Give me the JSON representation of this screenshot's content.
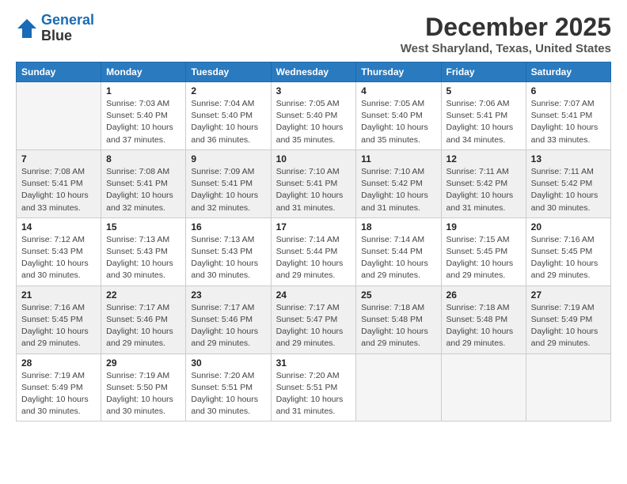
{
  "header": {
    "logo_line1": "General",
    "logo_line2": "Blue",
    "title": "December 2025",
    "location": "West Sharyland, Texas, United States"
  },
  "days_of_week": [
    "Sunday",
    "Monday",
    "Tuesday",
    "Wednesday",
    "Thursday",
    "Friday",
    "Saturday"
  ],
  "weeks": [
    [
      {
        "day": "",
        "info": ""
      },
      {
        "day": "1",
        "info": "Sunrise: 7:03 AM\nSunset: 5:40 PM\nDaylight: 10 hours\nand 37 minutes."
      },
      {
        "day": "2",
        "info": "Sunrise: 7:04 AM\nSunset: 5:40 PM\nDaylight: 10 hours\nand 36 minutes."
      },
      {
        "day": "3",
        "info": "Sunrise: 7:05 AM\nSunset: 5:40 PM\nDaylight: 10 hours\nand 35 minutes."
      },
      {
        "day": "4",
        "info": "Sunrise: 7:05 AM\nSunset: 5:40 PM\nDaylight: 10 hours\nand 35 minutes."
      },
      {
        "day": "5",
        "info": "Sunrise: 7:06 AM\nSunset: 5:41 PM\nDaylight: 10 hours\nand 34 minutes."
      },
      {
        "day": "6",
        "info": "Sunrise: 7:07 AM\nSunset: 5:41 PM\nDaylight: 10 hours\nand 33 minutes."
      }
    ],
    [
      {
        "day": "7",
        "info": "Sunrise: 7:08 AM\nSunset: 5:41 PM\nDaylight: 10 hours\nand 33 minutes."
      },
      {
        "day": "8",
        "info": "Sunrise: 7:08 AM\nSunset: 5:41 PM\nDaylight: 10 hours\nand 32 minutes."
      },
      {
        "day": "9",
        "info": "Sunrise: 7:09 AM\nSunset: 5:41 PM\nDaylight: 10 hours\nand 32 minutes."
      },
      {
        "day": "10",
        "info": "Sunrise: 7:10 AM\nSunset: 5:41 PM\nDaylight: 10 hours\nand 31 minutes."
      },
      {
        "day": "11",
        "info": "Sunrise: 7:10 AM\nSunset: 5:42 PM\nDaylight: 10 hours\nand 31 minutes."
      },
      {
        "day": "12",
        "info": "Sunrise: 7:11 AM\nSunset: 5:42 PM\nDaylight: 10 hours\nand 31 minutes."
      },
      {
        "day": "13",
        "info": "Sunrise: 7:11 AM\nSunset: 5:42 PM\nDaylight: 10 hours\nand 30 minutes."
      }
    ],
    [
      {
        "day": "14",
        "info": "Sunrise: 7:12 AM\nSunset: 5:43 PM\nDaylight: 10 hours\nand 30 minutes."
      },
      {
        "day": "15",
        "info": "Sunrise: 7:13 AM\nSunset: 5:43 PM\nDaylight: 10 hours\nand 30 minutes."
      },
      {
        "day": "16",
        "info": "Sunrise: 7:13 AM\nSunset: 5:43 PM\nDaylight: 10 hours\nand 30 minutes."
      },
      {
        "day": "17",
        "info": "Sunrise: 7:14 AM\nSunset: 5:44 PM\nDaylight: 10 hours\nand 29 minutes."
      },
      {
        "day": "18",
        "info": "Sunrise: 7:14 AM\nSunset: 5:44 PM\nDaylight: 10 hours\nand 29 minutes."
      },
      {
        "day": "19",
        "info": "Sunrise: 7:15 AM\nSunset: 5:45 PM\nDaylight: 10 hours\nand 29 minutes."
      },
      {
        "day": "20",
        "info": "Sunrise: 7:16 AM\nSunset: 5:45 PM\nDaylight: 10 hours\nand 29 minutes."
      }
    ],
    [
      {
        "day": "21",
        "info": "Sunrise: 7:16 AM\nSunset: 5:45 PM\nDaylight: 10 hours\nand 29 minutes."
      },
      {
        "day": "22",
        "info": "Sunrise: 7:17 AM\nSunset: 5:46 PM\nDaylight: 10 hours\nand 29 minutes."
      },
      {
        "day": "23",
        "info": "Sunrise: 7:17 AM\nSunset: 5:46 PM\nDaylight: 10 hours\nand 29 minutes."
      },
      {
        "day": "24",
        "info": "Sunrise: 7:17 AM\nSunset: 5:47 PM\nDaylight: 10 hours\nand 29 minutes."
      },
      {
        "day": "25",
        "info": "Sunrise: 7:18 AM\nSunset: 5:48 PM\nDaylight: 10 hours\nand 29 minutes."
      },
      {
        "day": "26",
        "info": "Sunrise: 7:18 AM\nSunset: 5:48 PM\nDaylight: 10 hours\nand 29 minutes."
      },
      {
        "day": "27",
        "info": "Sunrise: 7:19 AM\nSunset: 5:49 PM\nDaylight: 10 hours\nand 29 minutes."
      }
    ],
    [
      {
        "day": "28",
        "info": "Sunrise: 7:19 AM\nSunset: 5:49 PM\nDaylight: 10 hours\nand 30 minutes."
      },
      {
        "day": "29",
        "info": "Sunrise: 7:19 AM\nSunset: 5:50 PM\nDaylight: 10 hours\nand 30 minutes."
      },
      {
        "day": "30",
        "info": "Sunrise: 7:20 AM\nSunset: 5:51 PM\nDaylight: 10 hours\nand 30 minutes."
      },
      {
        "day": "31",
        "info": "Sunrise: 7:20 AM\nSunset: 5:51 PM\nDaylight: 10 hours\nand 31 minutes."
      },
      {
        "day": "",
        "info": ""
      },
      {
        "day": "",
        "info": ""
      },
      {
        "day": "",
        "info": ""
      }
    ]
  ]
}
